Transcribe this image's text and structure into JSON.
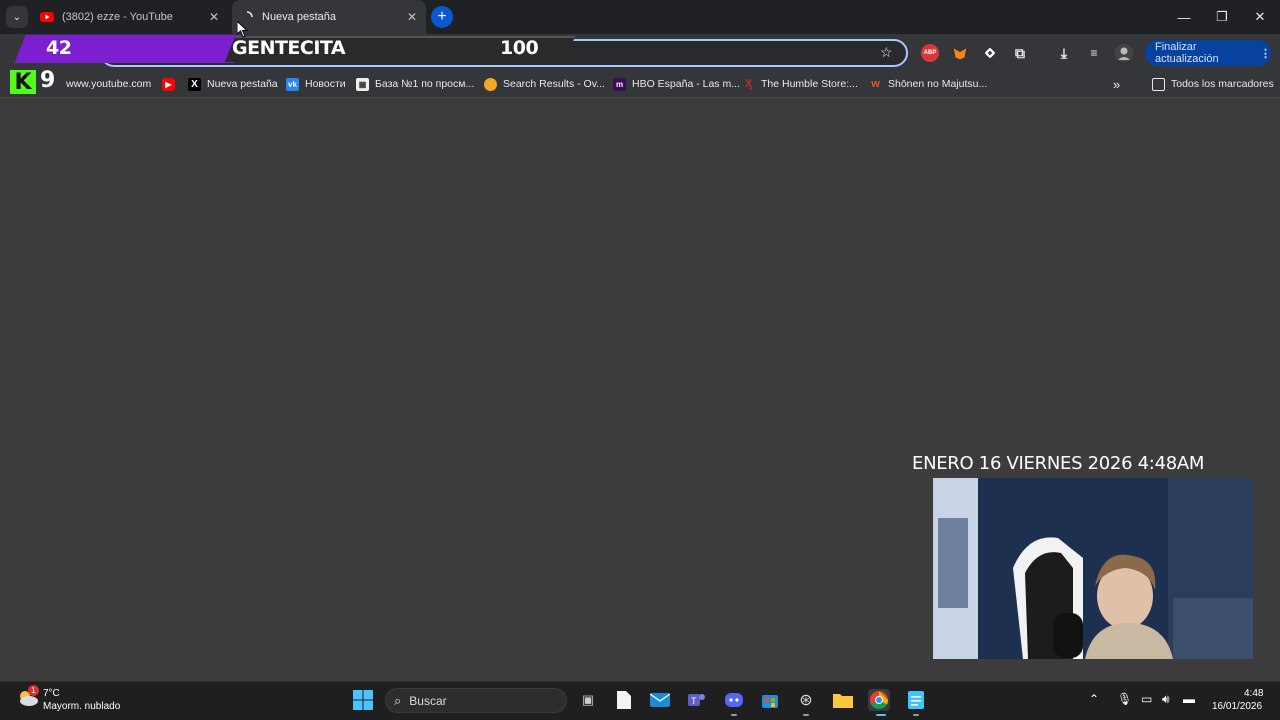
{
  "tabs": [
    {
      "title": "(3802) ezze - YouTube",
      "favicon": "youtube-icon",
      "active": false
    },
    {
      "title": "Nueva pestaña",
      "favicon": "loading-icon",
      "active": true
    }
  ],
  "toolbar": {
    "update_label": "Finalizar actualización",
    "extensions": [
      "adblock-plus-icon",
      "metamask-icon",
      "extension-diamond-icon",
      "puzzle-icon",
      "download-icon",
      "media-icon",
      "profile-avatar"
    ]
  },
  "overlay": {
    "left_count": "42",
    "channel": "GENTECITA",
    "right_count": "100",
    "kick_number": "9"
  },
  "bookmarks": [
    {
      "label": "www.youtube.com",
      "icon": "globe-icon"
    },
    {
      "label": "",
      "icon": "youtube-icon"
    },
    {
      "label": "Nueva pestaña",
      "icon": "x-icon"
    },
    {
      "label": "Новости",
      "icon": "vk-icon"
    },
    {
      "label": "База №1 по просм...",
      "icon": "shikimori-icon"
    },
    {
      "label": "Search Results - Ov...",
      "icon": "circle-icon"
    },
    {
      "label": "HBO España - Las m...",
      "icon": "m-icon"
    },
    {
      "label": "The Humble Store:...",
      "icon": "humble-icon"
    },
    {
      "label": "Shōnen no Majutsu...",
      "icon": "w-icon"
    }
  ],
  "all_bookmarks_label": "Todos los marcadores",
  "stream": {
    "datetime": "ENERO 16 VIERNES 2026 4:48AM"
  },
  "taskbar": {
    "weather_temp": "7°C",
    "weather_desc": "Mayorm. nublado",
    "weather_badge": "1",
    "search_placeholder": "Buscar",
    "time": "4:48",
    "date": "16/01/2026"
  },
  "colors": {
    "accent": "#0b57d0",
    "overlay_purple": "#7b1fd1",
    "kick_green": "#53fc18"
  }
}
